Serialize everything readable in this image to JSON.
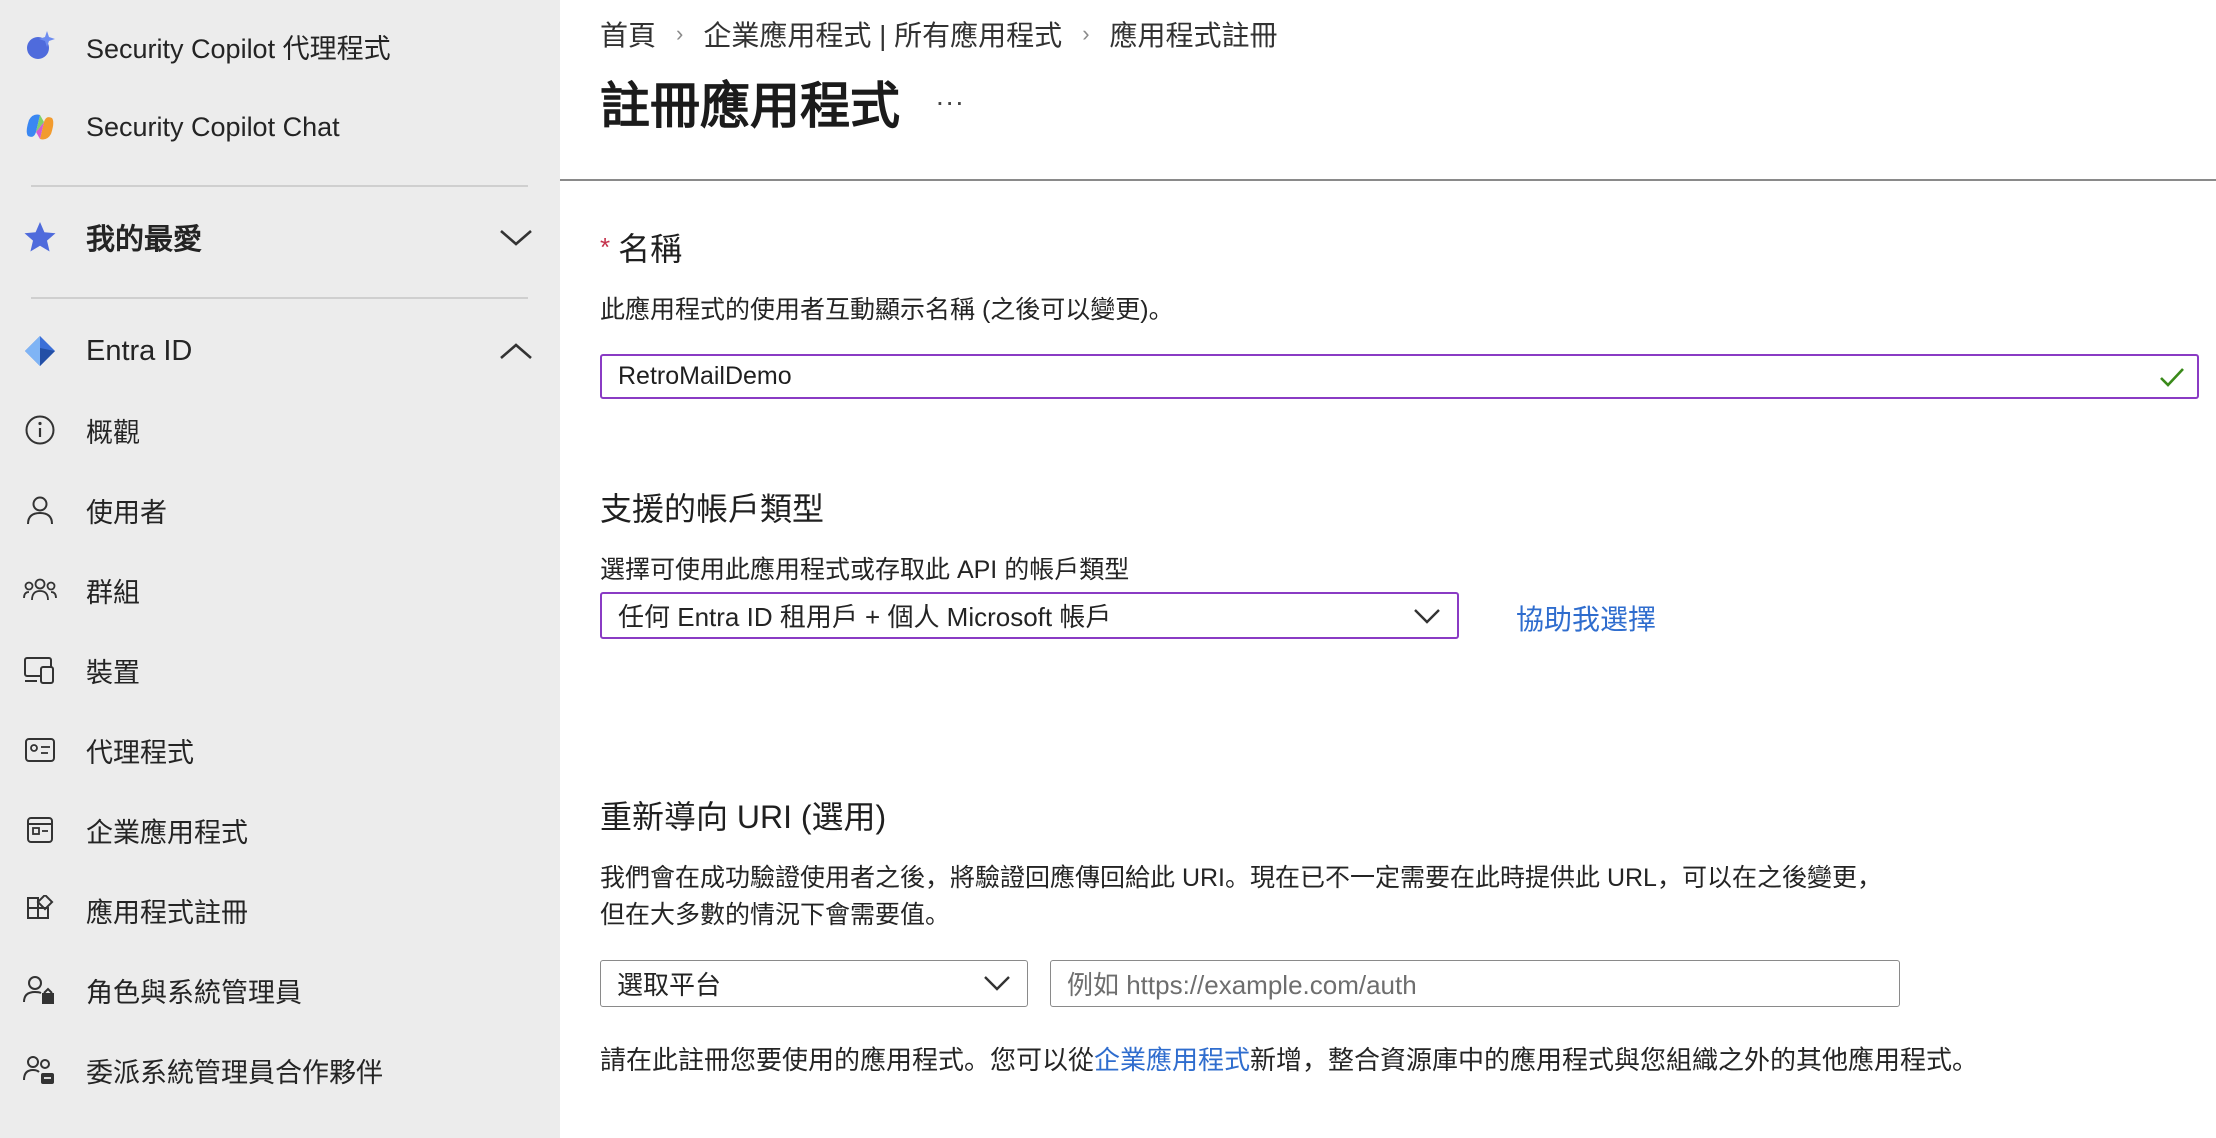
{
  "sidebar": {
    "items": [
      {
        "label": "Security Copilot 代理程式",
        "icon": "copilot-agent-icon"
      },
      {
        "label": "Security Copilot Chat",
        "icon": "copilot-chat-icon"
      },
      {
        "label": "我的最愛",
        "icon": "star-icon"
      },
      {
        "label": "Entra ID",
        "icon": "entra-id-icon"
      },
      {
        "label": "概觀",
        "icon": "info-icon"
      },
      {
        "label": "使用者",
        "icon": "user-icon"
      },
      {
        "label": "群組",
        "icon": "group-icon"
      },
      {
        "label": "裝置",
        "icon": "device-icon"
      },
      {
        "label": "代理程式",
        "icon": "agent-card-icon"
      },
      {
        "label": "企業應用程式",
        "icon": "enterprise-app-icon"
      },
      {
        "label": "應用程式註冊",
        "icon": "app-registration-icon"
      },
      {
        "label": "角色與系統管理員",
        "icon": "roles-icon"
      },
      {
        "label": "委派系統管理員合作夥伴",
        "icon": "partner-icon"
      }
    ]
  },
  "breadcrumb": {
    "items": [
      "首頁",
      "企業應用程式 | 所有應用程式",
      "應用程式註冊"
    ]
  },
  "page": {
    "title": "註冊應用程式",
    "more": "..."
  },
  "form": {
    "name": {
      "required_mark": "*",
      "label": "名稱",
      "description": "此應用程式的使用者互動顯示名稱 (之後可以變更)。",
      "value": "RetroMailDemo"
    },
    "account_types": {
      "label": "支援的帳戶類型",
      "description": "選擇可使用此應用程式或存取此 API 的帳戶類型",
      "selected": "任何 Entra ID 租用戶 + 個人 Microsoft 帳戶",
      "help_link": "協助我選擇"
    },
    "redirect": {
      "label": "重新導向 URI (選用)",
      "description_line1": "我們會在成功驗證使用者之後，將驗證回應傳回給此 URI。現在已不一定需要在此時提供此 URL，可以在之後變更，",
      "description_line2": "但在大多數的情況下會需要值。",
      "platform_select": "選取平台",
      "uri_placeholder": "例如 https://example.com/auth"
    },
    "footer": {
      "before": "請在此註冊您要使用的應用程式。您可以從",
      "link": "企業應用程式",
      "after": "新增，整合資源庫中的應用程式與您組織之外的其他應用程式。"
    }
  },
  "colors": {
    "accent_focus": "#8a3bc4",
    "link": "#2f6dce",
    "valid_check": "#3a8a1a",
    "required": "#c4314b"
  }
}
